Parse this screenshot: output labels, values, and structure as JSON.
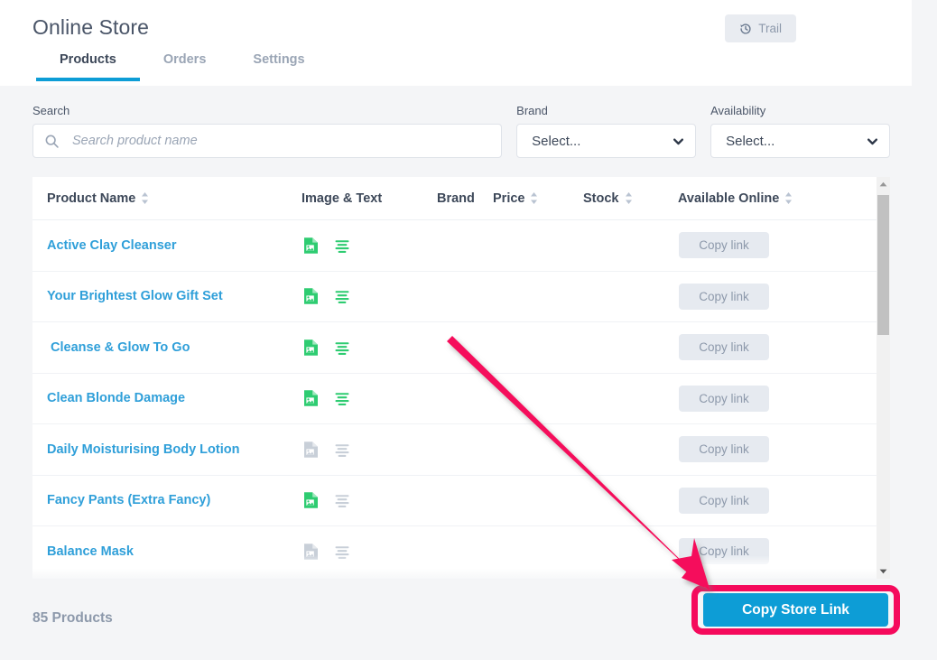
{
  "header": {
    "title": "Online Store",
    "trail_button": {
      "label": "Trail",
      "icon": "history-rewind-icon"
    },
    "tabs": [
      {
        "label": "Products",
        "active": true
      },
      {
        "label": "Orders",
        "active": false
      },
      {
        "label": "Settings",
        "active": false
      }
    ]
  },
  "filters": {
    "search": {
      "label": "Search",
      "placeholder": "Search product name",
      "value": "",
      "icon": "search-icon"
    },
    "brand": {
      "label": "Brand",
      "value": "Select...",
      "icon": "chevron-down-icon"
    },
    "availability": {
      "label": "Availability",
      "value": "Select...",
      "icon": "chevron-down-icon"
    }
  },
  "table": {
    "columns": [
      {
        "label": "Product Name",
        "sortable": true
      },
      {
        "label": "Image & Text",
        "sortable": false
      },
      {
        "label": "Brand",
        "sortable": false
      },
      {
        "label": "Price",
        "sortable": true
      },
      {
        "label": "Stock",
        "sortable": true
      },
      {
        "label": "Available Online",
        "sortable": true
      }
    ],
    "rows": [
      {
        "name": "Active Clay Cleanser",
        "image_ok": true,
        "text_ok": true,
        "brand": "",
        "price": "",
        "stock": "",
        "copy_label": "Copy link"
      },
      {
        "name": "Your Brightest Glow Gift Set",
        "image_ok": true,
        "text_ok": true,
        "brand": "",
        "price": "",
        "stock": "",
        "copy_label": "Copy link"
      },
      {
        "name": " Cleanse & Glow To Go",
        "image_ok": true,
        "text_ok": true,
        "brand": "",
        "price": "",
        "stock": "",
        "copy_label": "Copy link"
      },
      {
        "name": "Clean Blonde Damage",
        "image_ok": true,
        "text_ok": true,
        "brand": "",
        "price": "",
        "stock": "",
        "copy_label": "Copy link"
      },
      {
        "name": "Daily Moisturising Body Lotion",
        "image_ok": false,
        "text_ok": false,
        "brand": "",
        "price": "",
        "stock": "",
        "copy_label": "Copy link"
      },
      {
        "name": "Fancy Pants (Extra Fancy)",
        "image_ok": true,
        "text_ok": false,
        "brand": "",
        "price": "",
        "stock": "",
        "copy_label": "Copy link"
      },
      {
        "name": "Balance Mask",
        "image_ok": false,
        "text_ok": false,
        "brand": "",
        "price": "",
        "stock": "",
        "copy_label": "Copy link"
      },
      {
        "name": "",
        "image_ok": false,
        "text_ok": false,
        "brand": "",
        "price": "",
        "stock": "",
        "copy_label": ""
      }
    ]
  },
  "scrollbar": {
    "up_icon": "triangle-up-icon",
    "down_icon": "triangle-down-icon"
  },
  "footer": {
    "count_text": "85 Products",
    "cta_label": "Copy Store Link"
  },
  "annotation": {
    "arrow_color": "#f50a5c",
    "highlight_color": "#f50a5c"
  },
  "colors": {
    "accent_blue": "#0d9dd6",
    "link_blue": "#2f9fd9",
    "icon_green": "#2ecc71",
    "icon_gray": "#c8cfd8",
    "muted_text": "#8d99ab",
    "page_bg": "#f4f5f7"
  }
}
